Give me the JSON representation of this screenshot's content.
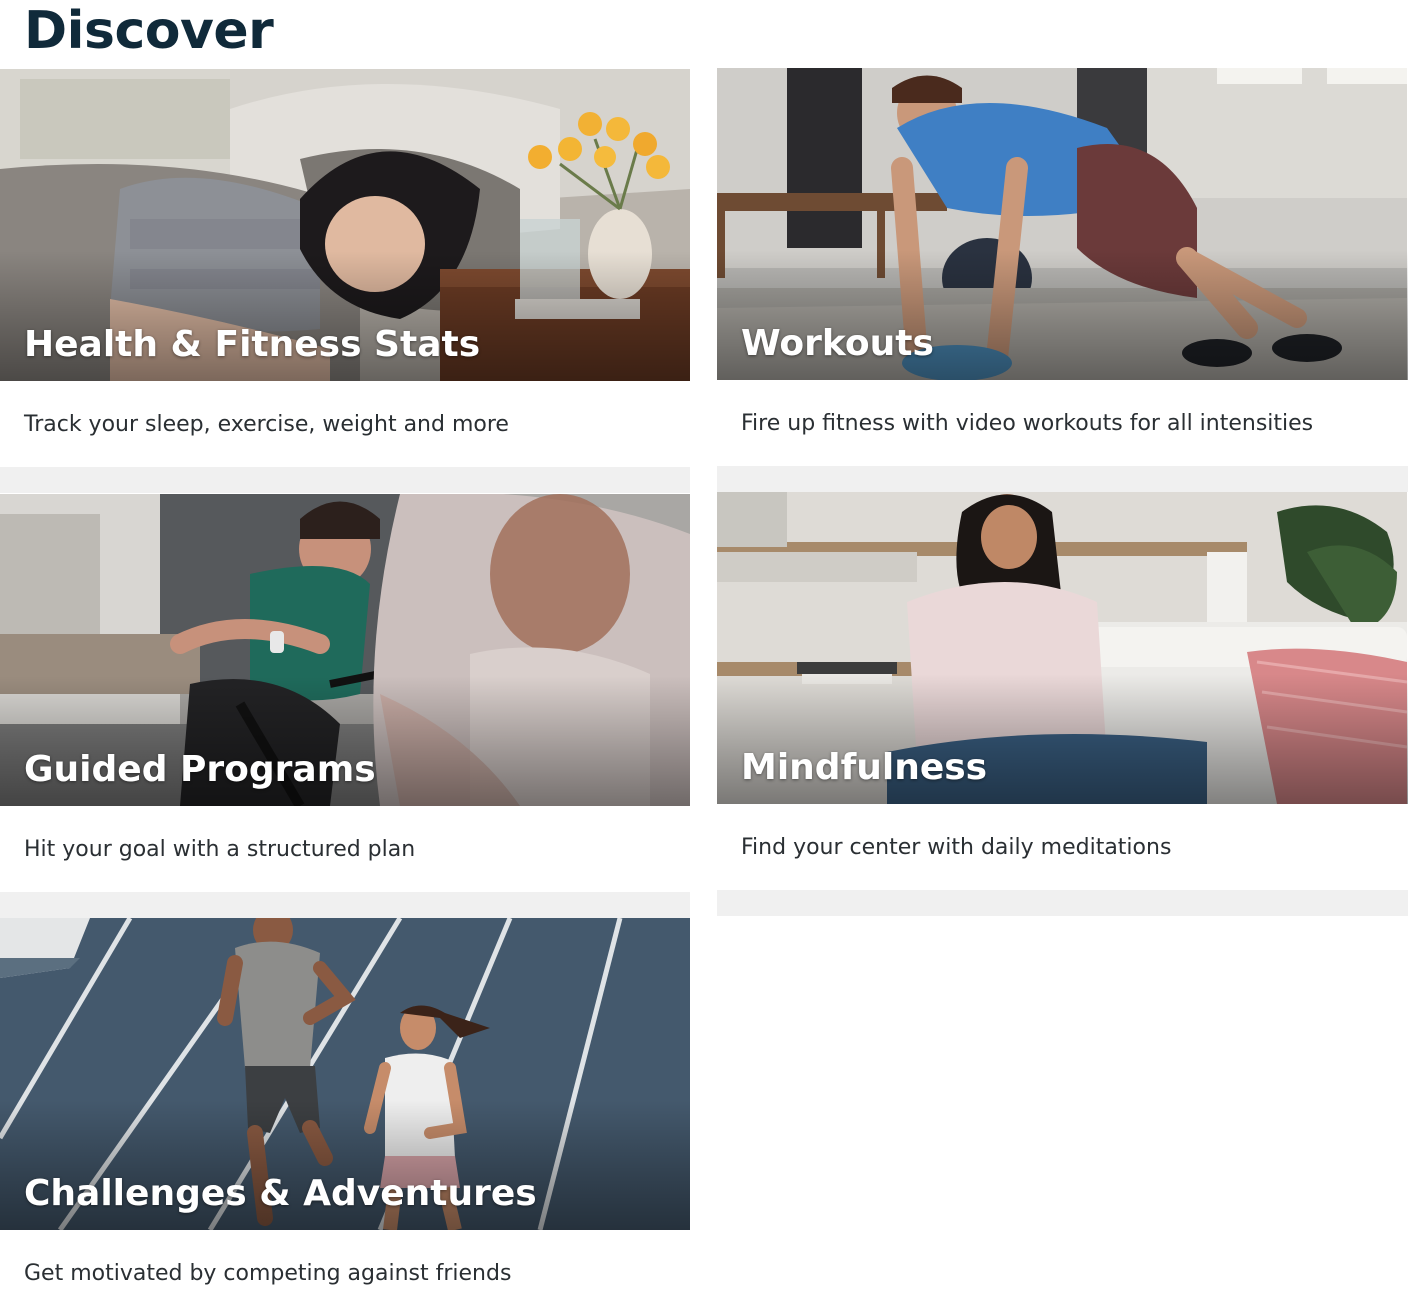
{
  "page": {
    "title": "Discover"
  },
  "cards": [
    {
      "id": "health-fitness-stats",
      "title": "Health & Fitness Stats",
      "description": "Track your sleep, exercise, weight and more"
    },
    {
      "id": "workouts",
      "title": "Workouts",
      "description": "Fire up fitness with video workouts for all intensities"
    },
    {
      "id": "guided-programs",
      "title": "Guided Programs",
      "description": "Hit your goal with a structured plan"
    },
    {
      "id": "mindfulness",
      "title": "Mindfulness",
      "description": "Find your center with daily meditations"
    },
    {
      "id": "challenges-adventures",
      "title": "Challenges & Adventures",
      "description": "Get motivated by competing against friends"
    }
  ],
  "colors": {
    "title": "#102a3a",
    "description": "#2a2f33",
    "separator": "#f0f0f0",
    "card_title": "#ffffff"
  }
}
